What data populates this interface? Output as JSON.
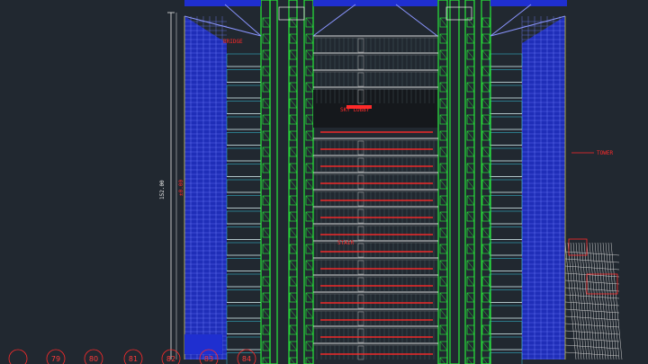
{
  "colors": {
    "background": "#212830",
    "curtain_wall": "#1f2fd0",
    "core_green": "#27e83a",
    "slab_white": "#dcdcdc",
    "annotation_red": "#ff2a2a",
    "mullion_cyan": "#38c8e0",
    "truss_yellow": "#c8c040"
  },
  "drawing": {
    "dimension_total": "152.00",
    "dimension_sub": "±0.00",
    "label_sky_lobby": "SKY LOBBY",
    "label_tower": "TOWER",
    "label_bridge": "BRIDGE",
    "label_stair": "STAIR"
  },
  "grid_bubbles": [
    "79",
    "80",
    "81",
    "82",
    "83",
    "84"
  ],
  "icons": {
    "elevation": "cad-building-elevation",
    "grid": "grid-axis-bubble",
    "level": "level-marker-icon"
  }
}
